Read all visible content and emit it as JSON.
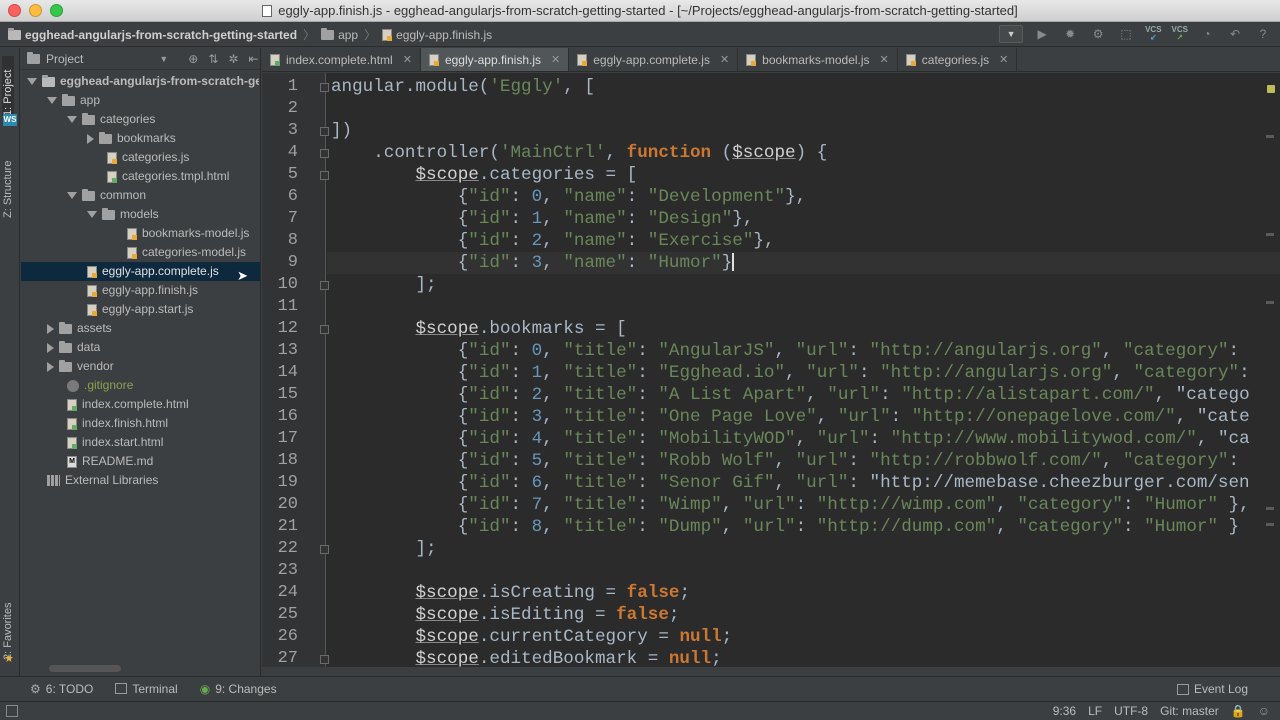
{
  "window": {
    "title": "eggly-app.finish.js - egghead-angularjs-from-scratch-getting-started - [~/Projects/egghead-angularjs-from-scratch-getting-started]"
  },
  "breadcrumb": {
    "items": [
      {
        "label": "egghead-angularjs-from-scratch-getting-started",
        "icon": "folder-icon"
      },
      {
        "label": "app",
        "icon": "folder-icon"
      },
      {
        "label": "eggly-app.finish.js",
        "icon": "js-file-icon"
      }
    ]
  },
  "toolbar": {
    "vcs_update_label": "VCS",
    "vcs_commit_label": "VCS"
  },
  "side_strip": {
    "project_tab": "1: Project",
    "structure_tab": "Z: Structure",
    "favorites_tab": "2: Favorites"
  },
  "project_panel": {
    "header": "Project",
    "tree": [
      {
        "label": "egghead-angularjs-from-scratch-getting-started",
        "type": "folder",
        "expanded": true
      },
      {
        "label": "app",
        "type": "folder",
        "expanded": true
      },
      {
        "label": "categories",
        "type": "folder",
        "expanded": true
      },
      {
        "label": "bookmarks",
        "type": "folder",
        "expanded": false
      },
      {
        "label": "categories.js",
        "type": "js"
      },
      {
        "label": "categories.tmpl.html",
        "type": "html"
      },
      {
        "label": "common",
        "type": "folder",
        "expanded": true
      },
      {
        "label": "models",
        "type": "folder",
        "expanded": true
      },
      {
        "label": "bookmarks-model.js",
        "type": "js"
      },
      {
        "label": "categories-model.js",
        "type": "js"
      },
      {
        "label": "eggly-app.complete.js",
        "type": "js",
        "selected": true
      },
      {
        "label": "eggly-app.finish.js",
        "type": "js"
      },
      {
        "label": "eggly-app.start.js",
        "type": "js"
      },
      {
        "label": "assets",
        "type": "folder",
        "expanded": false
      },
      {
        "label": "data",
        "type": "folder",
        "expanded": false
      },
      {
        "label": "vendor",
        "type": "folder",
        "expanded": false
      },
      {
        "label": ".gitignore",
        "type": "gitignore"
      },
      {
        "label": "index.complete.html",
        "type": "html"
      },
      {
        "label": "index.finish.html",
        "type": "html"
      },
      {
        "label": "index.start.html",
        "type": "html"
      },
      {
        "label": "README.md",
        "type": "md"
      },
      {
        "label": "External Libraries",
        "type": "library"
      }
    ]
  },
  "editor_tabs": [
    {
      "label": "index.complete.html",
      "icon": "html-file-icon",
      "active": false
    },
    {
      "label": "eggly-app.finish.js",
      "icon": "js-file-icon",
      "active": true
    },
    {
      "label": "eggly-app.complete.js",
      "icon": "js-file-icon",
      "active": false
    },
    {
      "label": "bookmarks-model.js",
      "icon": "js-file-icon",
      "active": false
    },
    {
      "label": "categories.js",
      "icon": "js-file-icon",
      "active": false
    }
  ],
  "editor": {
    "first_line": 1,
    "current_line": 9,
    "lines": [
      "angular.module('Eggly', [",
      "",
      "])",
      "    .controller('MainCtrl', function ($scope) {",
      "        $scope.categories = [",
      "            {\"id\": 0, \"name\": \"Development\"},",
      "            {\"id\": 1, \"name\": \"Design\"},",
      "            {\"id\": 2, \"name\": \"Exercise\"},",
      "            {\"id\": 3, \"name\": \"Humor\"}",
      "        ];",
      "",
      "        $scope.bookmarks = [",
      "            {\"id\": 0, \"title\": \"AngularJS\", \"url\": \"http://angularjs.org\", \"category\": ",
      "            {\"id\": 1, \"title\": \"Egghead.io\", \"url\": \"http://angularjs.org\", \"category\":",
      "            {\"id\": 2, \"title\": \"A List Apart\", \"url\": \"http://alistapart.com/\", \"catego",
      "            {\"id\": 3, \"title\": \"One Page Love\", \"url\": \"http://onepagelove.com/\", \"cate",
      "            {\"id\": 4, \"title\": \"MobilityWOD\", \"url\": \"http://www.mobilitywod.com/\", \"ca",
      "            {\"id\": 5, \"title\": \"Robb Wolf\", \"url\": \"http://robbwolf.com/\", \"category\": ",
      "            {\"id\": 6, \"title\": \"Senor Gif\", \"url\": \"http://memebase.cheezburger.com/sen",
      "            {\"id\": 7, \"title\": \"Wimp\", \"url\": \"http://wimp.com\", \"category\": \"Humor\" },",
      "            {\"id\": 8, \"title\": \"Dump\", \"url\": \"http://dump.com\", \"category\": \"Humor\" }",
      "        ];",
      "",
      "        $scope.isCreating = false;",
      "        $scope.isEditing = false;",
      "        $scope.currentCategory = null;",
      "        $scope.editedBookmark = null;"
    ]
  },
  "bottom_tools": {
    "todo": "6: TODO",
    "terminal": "Terminal",
    "changes": "9: Changes",
    "event_log": "Event Log"
  },
  "status": {
    "position": "9:36",
    "line_sep": "LF",
    "encoding": "UTF-8",
    "vcs_branch": "Git: master"
  },
  "colors": {
    "keyword": "#cc7832",
    "string": "#6a8759",
    "number": "#6897bb",
    "selection": "#0d293e",
    "editor_bg": "#2b2b2b"
  }
}
